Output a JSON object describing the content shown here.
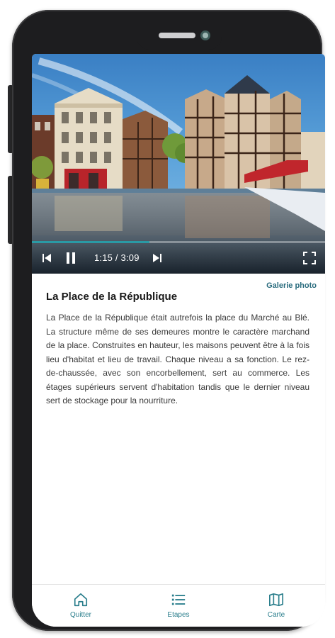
{
  "player": {
    "current_time": "1:15",
    "separator": " / ",
    "duration": "3:09",
    "progress": 0.4
  },
  "content": {
    "gallery_link": "Galerie photo",
    "title": "La Place de la République",
    "description": "La Place de la République était autrefois la place du Marché au Blé. La structure même de ses demeures montre le caractère marchand de la place. Construites en hauteur, les maisons peuvent être à la fois lieu d'habitat et lieu de travail. Chaque niveau a sa fonction. Le rez-de-chaussée, avec son encorbellement, sert au commerce. Les étages supérieurs servent d'habitation tandis que le dernier niveau sert de stockage pour la nourriture."
  },
  "nav": {
    "items": [
      {
        "label": "Quitter",
        "icon": "home-icon"
      },
      {
        "label": "Etapes",
        "icon": "list-icon"
      },
      {
        "label": "Carte",
        "icon": "map-icon"
      }
    ]
  },
  "colors": {
    "accent": "#2a7e8c",
    "progress": "#2a9aa5",
    "text": "#3a3a3a"
  }
}
